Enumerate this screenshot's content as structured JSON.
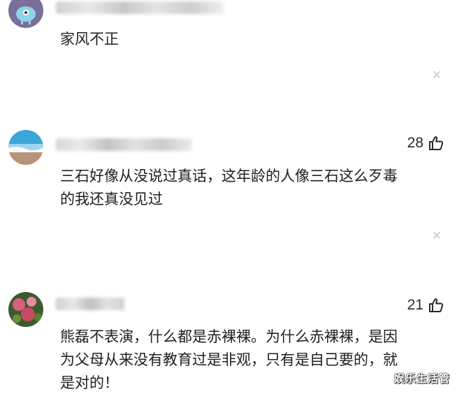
{
  "comments": [
    {
      "text": "家风不正",
      "likes": null,
      "avatar_icon": "cartoon-alien-avatar",
      "dismiss_icon": "close-icon"
    },
    {
      "text": "三石好像从没说过真话，这年龄的人像三石这么歹毒\n的我还真没见过",
      "likes": "28",
      "avatar_icon": "sea-wave-avatar",
      "dismiss_icon": "close-icon"
    },
    {
      "text": "熊磊不表演，什么都是赤裸裸。为什么赤裸裸，是因\n为父母从来没有教育过是非观，只有是自己要的，就\n是对的！",
      "likes": "21",
      "avatar_icon": "flowers-avatar",
      "dismiss_icon": "close-icon"
    }
  ],
  "dismiss_glyph": "✕",
  "watermark": "娱乐生活管",
  "colors": {
    "text": "#202020",
    "dismiss": "#c8c8c8",
    "background": "#ffffff"
  }
}
